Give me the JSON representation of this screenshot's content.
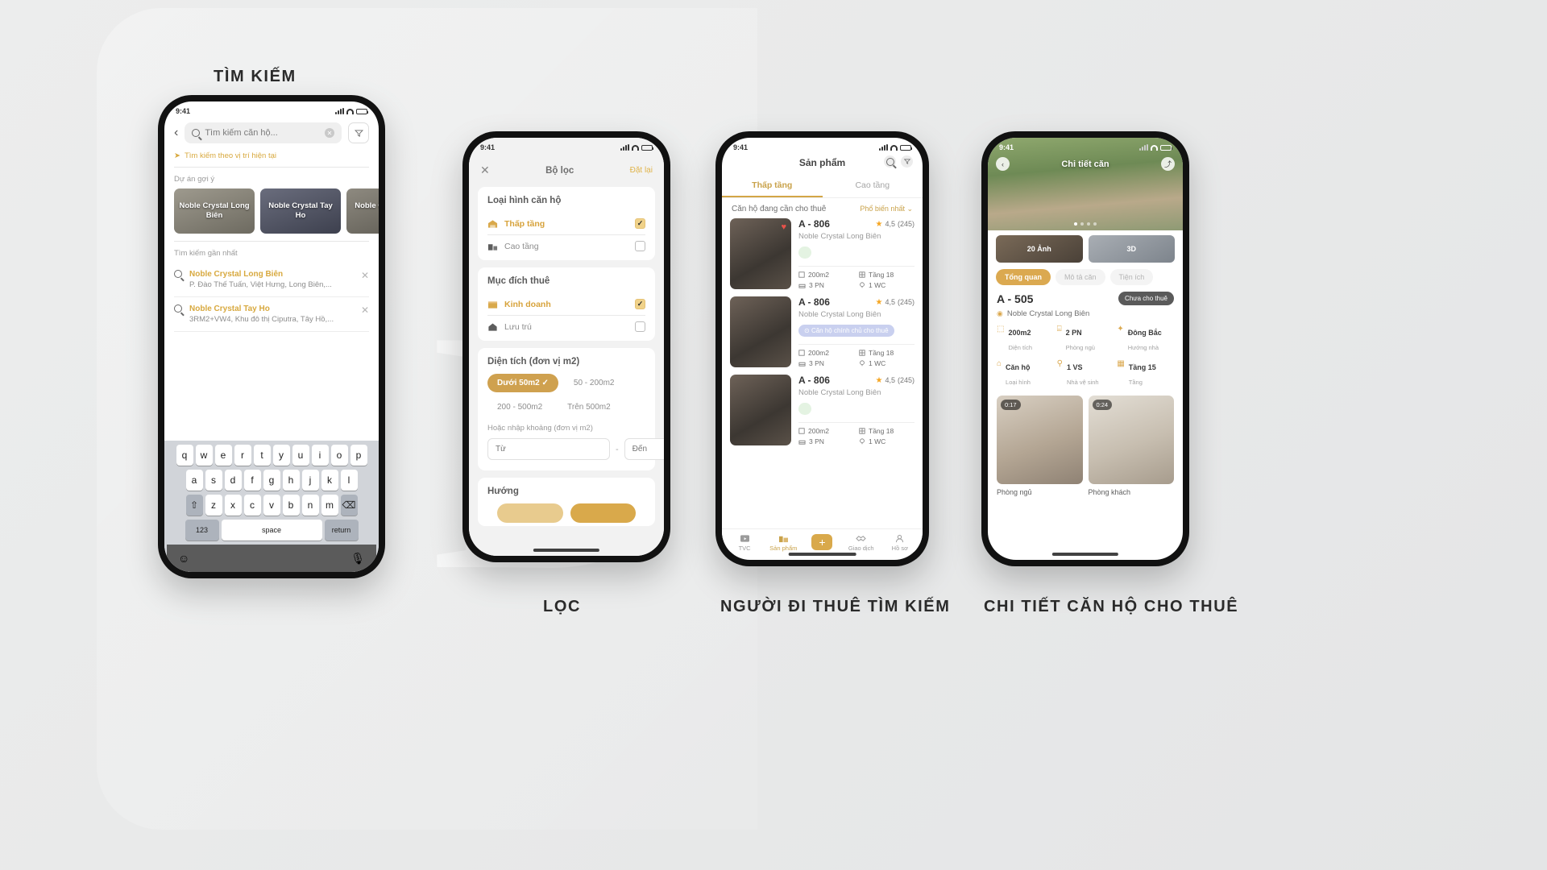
{
  "captions": {
    "search": "TÌM KIẾM",
    "filter": "LỌC",
    "renter_search": "NGƯỜI ĐI THUÊ TÌM KIẾM",
    "detail": "CHI TIẾT CĂN HỘ CHO THUÊ"
  },
  "watermark_letter": "D",
  "colors": {
    "accent": "#d9a94b",
    "accent_text": "#d8a93f",
    "star": "#f5a623",
    "dark": "#2f2f2f"
  },
  "phone1": {
    "status_time": "9:41",
    "search": {
      "placeholder": "Tìm kiếm căn hộ...",
      "value": ""
    },
    "back_icon": "chevron-left-icon",
    "clear_icon": "clear-icon",
    "filter_icon": "funnel-icon",
    "location_hint": "Tìm kiếm theo vị trí hiện tại",
    "suggest_title": "Dự án gợi ý",
    "projects": [
      {
        "name": "Noble Crystal Long Biên"
      },
      {
        "name": "Noble Crystal Tay Ho"
      },
      {
        "name": "Noble Crystal Tay Ho"
      }
    ],
    "recent_title": "Tìm kiếm gần nhất",
    "recents": [
      {
        "title": "Noble Crystal Long Biên",
        "address": "P. Đào Thế Tuấn, Việt Hưng, Long Biên,..."
      },
      {
        "title": "Noble Crystal Tay Ho",
        "address": "3RM2+VW4, Khu đô thị Ciputra, Tây Hồ,..."
      }
    ],
    "keyboard": {
      "row1": [
        "q",
        "w",
        "e",
        "r",
        "t",
        "y",
        "u",
        "i",
        "o",
        "p"
      ],
      "row2": [
        "a",
        "s",
        "d",
        "f",
        "g",
        "h",
        "j",
        "k",
        "l"
      ],
      "row3": [
        "z",
        "x",
        "c",
        "v",
        "b",
        "n",
        "m"
      ],
      "shift": "⇧",
      "backspace": "⌫",
      "numbers": "123",
      "space": "space",
      "return": "return",
      "emoji": "emoji-icon",
      "mic": "mic-icon"
    }
  },
  "phone2": {
    "status_time": "9:41",
    "title": "Bộ lọc",
    "close_icon": "close-icon",
    "reset": "Đặt lại",
    "sections": [
      {
        "title": "Loại hình căn hộ",
        "options": [
          {
            "label": "Thấp tầng",
            "icon": "low-rise-icon",
            "checked": true
          },
          {
            "label": "Cao tầng",
            "icon": "high-rise-icon",
            "checked": false
          }
        ]
      },
      {
        "title": "Mục đích thuê",
        "options": [
          {
            "label": "Kinh doanh",
            "icon": "store-icon",
            "checked": true
          },
          {
            "label": "Lưu trú",
            "icon": "home-icon",
            "checked": false
          }
        ]
      }
    ],
    "area": {
      "title": "Diện tích (đơn vị m2)",
      "chips": [
        {
          "label": "Dưới 50m2",
          "selected": true
        },
        {
          "label": "50 - 200m2",
          "selected": false
        },
        {
          "label": "200 - 500m2",
          "selected": false
        },
        {
          "label": "Trên 500m2",
          "selected": false
        }
      ],
      "manual_label": "Hoặc nhập khoảng (đơn vị m2)",
      "from_placeholder": "Từ",
      "to_placeholder": "Đến"
    },
    "direction_title": "Hướng"
  },
  "phone3": {
    "status_time": "9:41",
    "title": "Sản phẩm",
    "search_icon": "search-icon",
    "filter_icon": "filter-icon",
    "tabs": [
      {
        "label": "Thấp tầng",
        "active": true
      },
      {
        "label": "Cao tầng",
        "active": false
      }
    ],
    "list_header": "Căn hộ đang cần cho thuê",
    "sort_label": "Phổ biến nhất",
    "listings": [
      {
        "name": "A - 806",
        "rating": "4,5",
        "reviews": "(245)",
        "project": "Noble Crystal Long Biên",
        "badge": "",
        "badge_kind": "green",
        "favorite": true,
        "specs": [
          {
            "icon": "area-icon",
            "value": "200m2"
          },
          {
            "icon": "floor-icon",
            "value": "Tầng 18"
          },
          {
            "icon": "bed-icon",
            "value": "3 PN"
          },
          {
            "icon": "wc-icon",
            "value": "1 WC"
          }
        ]
      },
      {
        "name": "A - 806",
        "rating": "4,5",
        "reviews": "(245)",
        "project": "Noble Crystal Long Biên",
        "badge": "Căn hộ chính chủ cho thuê",
        "badge_kind": "blue",
        "favorite": false,
        "specs": [
          {
            "icon": "area-icon",
            "value": "200m2"
          },
          {
            "icon": "floor-icon",
            "value": "Tầng 18"
          },
          {
            "icon": "bed-icon",
            "value": "3 PN"
          },
          {
            "icon": "wc-icon",
            "value": "1 WC"
          }
        ]
      },
      {
        "name": "A - 806",
        "rating": "4,5",
        "reviews": "(245)",
        "project": "Noble Crystal Long Biên",
        "badge": "",
        "badge_kind": "green",
        "favorite": false,
        "specs": [
          {
            "icon": "area-icon",
            "value": "200m2"
          },
          {
            "icon": "floor-icon",
            "value": "Tầng 18"
          },
          {
            "icon": "bed-icon",
            "value": "3 PN"
          },
          {
            "icon": "wc-icon",
            "value": "1 WC"
          }
        ]
      }
    ],
    "nav": [
      {
        "label": "TVC",
        "icon": "play-icon",
        "active": false
      },
      {
        "label": "Sản phẩm",
        "icon": "building-icon",
        "active": true
      },
      {
        "label": "",
        "icon": "plus-icon",
        "active": false
      },
      {
        "label": "Giao dịch",
        "icon": "handshake-icon",
        "active": false
      },
      {
        "label": "Hồ sơ",
        "icon": "person-icon",
        "active": false
      }
    ]
  },
  "phone4": {
    "status_time": "9:41",
    "title": "Chi tiết căn",
    "back_icon": "chevron-left-icon",
    "share_icon": "share-icon",
    "media": [
      {
        "label": "20 Ảnh",
        "kind": "photos"
      },
      {
        "label": "3D",
        "kind": "threed"
      }
    ],
    "pills": [
      {
        "label": "Tổng quan",
        "active": true
      },
      {
        "label": "Mô tả căn",
        "active": false
      },
      {
        "label": "Tiện ích",
        "active": false
      }
    ],
    "unit_name": "A - 505",
    "status_badge": "Chưa cho thuê",
    "project": "Noble Crystal Long Biên",
    "specs": [
      {
        "icon": "area-icon",
        "value": "200m2",
        "key": "Diện tích"
      },
      {
        "icon": "bed-icon",
        "value": "2 PN",
        "key": "Phòng ngủ"
      },
      {
        "icon": "compass-icon",
        "value": "Đông Bắc",
        "key": "Hướng nhà"
      },
      {
        "icon": "home-icon",
        "value": "Căn hộ",
        "key": "Loại hình"
      },
      {
        "icon": "wc-icon",
        "value": "1 VS",
        "key": "Nhà vệ sinh"
      },
      {
        "icon": "floor-icon",
        "value": "Tầng 15",
        "key": "Tầng"
      }
    ],
    "rooms": [
      {
        "label": "Phòng ngủ",
        "time": "0:17"
      },
      {
        "label": "Phòng khách",
        "time": "0:24"
      }
    ]
  }
}
